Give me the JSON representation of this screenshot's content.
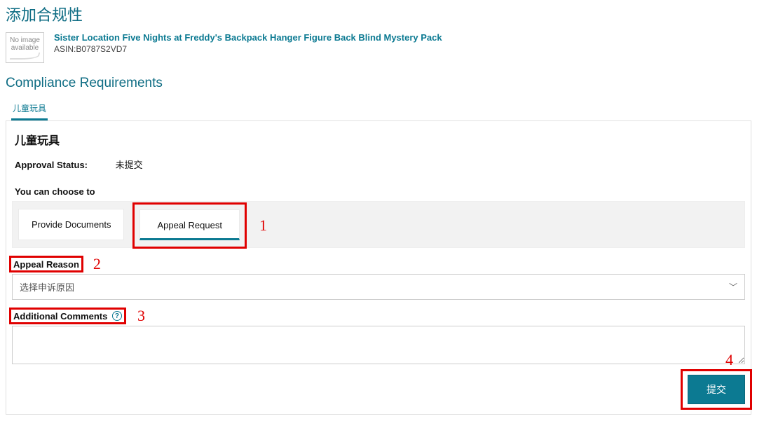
{
  "page": {
    "title": "添加合规性"
  },
  "product": {
    "thumb_text": "No image available",
    "title": "Sister Location Five Nights at Freddy's Backpack Hanger Figure Back Blind Mystery Pack",
    "asin_label": "ASIN:B0787S2VD7"
  },
  "section": {
    "heading": "Compliance Requirements"
  },
  "tab": {
    "label": "儿童玩具"
  },
  "panel": {
    "heading": "儿童玩具",
    "status_label": "Approval Status:",
    "status_value": "未提交",
    "choose_label": "You can choose to",
    "choice_provide": "Provide Documents",
    "choice_appeal": "Appeal Request",
    "appeal_reason_label": "Appeal Reason",
    "appeal_reason_placeholder": "选择申诉原因",
    "additional_label": "Additional Comments",
    "submit_label": "提交"
  },
  "callouts": {
    "n1": "1",
    "n2": "2",
    "n3": "3",
    "n4": "4"
  }
}
